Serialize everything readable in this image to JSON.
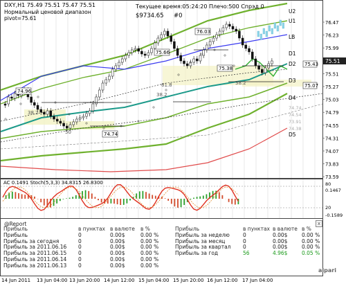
{
  "chart": {
    "title": "DXY,H1  75.49 75.51 75.47 75.51",
    "subtitle_line1": "Нормальный ценовой диапазон",
    "subtitle_line2": "pivot=75.61",
    "server_time": "Текущее время:05:24:20 Плечо:500 Спрэд 0",
    "balance": "$9734.65",
    "balance_suffix": "#0",
    "current_price": "75.51",
    "price_axis": [
      "76.47",
      "76.23",
      "75.99",
      "75.75",
      "75.51",
      "75.27",
      "75.03",
      "74.79",
      "74.55",
      "74.31",
      "74.07",
      "73.83",
      "73.59"
    ],
    "level_labels": [
      "U2",
      "U1",
      "LB",
      "D1",
      "D2",
      "D3",
      "D4",
      "D5"
    ],
    "level_prices": [
      "75.43",
      "75.07"
    ],
    "annotations": [
      "74.96",
      "76.03",
      "75.66",
      "75.38",
      "38.2",
      "38.2",
      "38.2",
      "50",
      "74.74",
      "61.8"
    ],
    "right_faint_numbers": [
      "74.74",
      "74.54",
      "73.91",
      "74.38"
    ],
    "colors": {
      "background": "#ffffff",
      "grid": "#d8d8d8",
      "upper_band": "#6fb12e",
      "blue_line": "#3a3af0",
      "teal_line": "#1c9a8a",
      "red_line": "#e04a4a",
      "price_candles": "#2fae2f",
      "highlight": "#f3f2c4"
    }
  },
  "indicator": {
    "label": "AC 0.1491 Stoch(5,3,3) 34.8315 26.8300",
    "axis": [
      "80",
      "0.1467",
      "20",
      "-0.1589"
    ]
  },
  "report": {
    "title": "@Report",
    "close_icon": "x",
    "left_headers": [
      "Прибыль",
      "в пунктах",
      "в валюте",
      "в %"
    ],
    "left_rows": [
      [
        "Прибыль",
        "0",
        "0.00$",
        "0.00 %"
      ],
      [
        "Прибыль за сегодня",
        "0",
        "0.00$",
        "0.00 %"
      ],
      [
        "Прибыль за 2011.06.16",
        "0",
        "0.00$",
        "0.00 %"
      ],
      [
        "Прибыль за 2011.06.15",
        "0",
        "0.00$",
        "0.00 %"
      ],
      [
        "Прибыль за 2011.06.14",
        "0",
        "0.00$",
        "0.00 %"
      ],
      [
        "Прибыль за 2011.06.13",
        "0",
        "0.00$",
        "0.00 %"
      ]
    ],
    "right_headers": [
      "Прибыль",
      "в пунктах",
      "в валюте",
      "в %"
    ],
    "right_rows": [
      [
        "Прибыль за неделю",
        "0",
        "0.00$",
        "0.00 %"
      ],
      [
        "Прибыль за месяц",
        "0",
        "0.00$",
        "0.00 %"
      ],
      [
        "Прибыль за квартал",
        "0",
        "0.00$",
        "0.00 %"
      ],
      [
        "Прибыль за год",
        "56",
        "4.96$",
        "0.05 %"
      ]
    ],
    "logo": "alpari"
  },
  "time_axis": [
    "14 Jun 2011",
    "13 Jun 04:00",
    "13 Jun 20:00",
    "14 Jun 12:00",
    "15 Jun 04:00",
    "15 Jun 20:00",
    "16 Jun 12:00",
    "17 Jun 04:00"
  ]
}
